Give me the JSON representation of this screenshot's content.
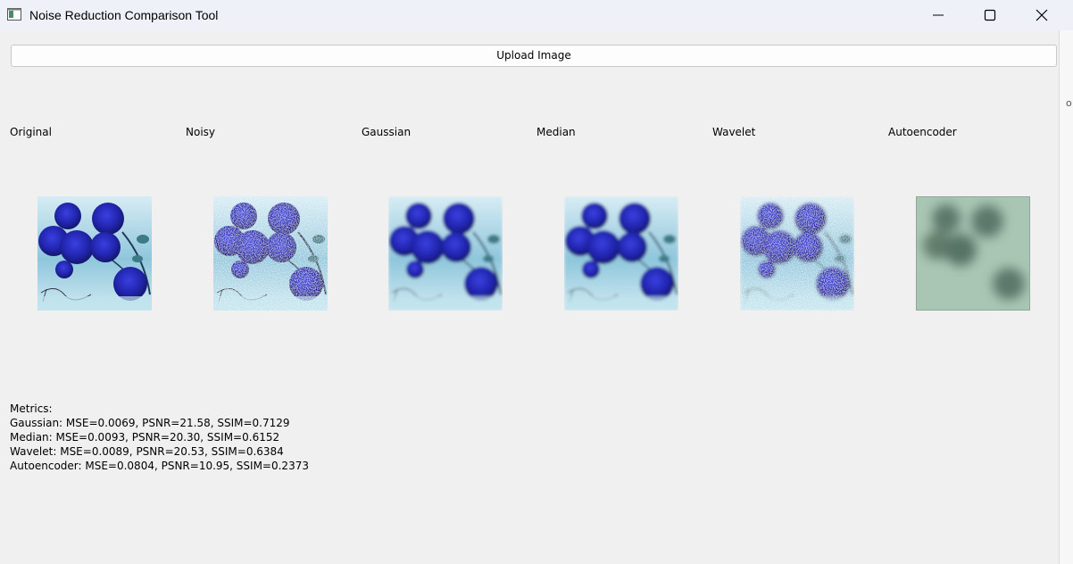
{
  "window": {
    "title": "Noise Reduction Comparison Tool",
    "icon": "app-window-icon",
    "controls": [
      "minimize-icon",
      "maximize-icon",
      "close-icon"
    ]
  },
  "toolbar": {
    "upload_label": "Upload Image"
  },
  "panels": [
    {
      "label": "Original"
    },
    {
      "label": "Noisy"
    },
    {
      "label": "Gaussian"
    },
    {
      "label": "Median"
    },
    {
      "label": "Wavelet"
    },
    {
      "label": "Autoencoder"
    }
  ],
  "metrics": {
    "heading": "Metrics:",
    "lines": [
      "Gaussian: MSE=0.0069, PSNR=21.58, SSIM=0.7129",
      "Median: MSE=0.0093, PSNR=20.30, SSIM=0.6152",
      "Wavelet: MSE=0.0089, PSNR=20.53, SSIM=0.6384",
      "Autoencoder: MSE=0.0804, PSNR=10.95, SSIM=0.2373"
    ]
  },
  "edge_glyph": "o",
  "colors": {
    "rose": "#2b2fb8",
    "background": "#f0f0f0",
    "titlebar": "#eef2f8"
  }
}
